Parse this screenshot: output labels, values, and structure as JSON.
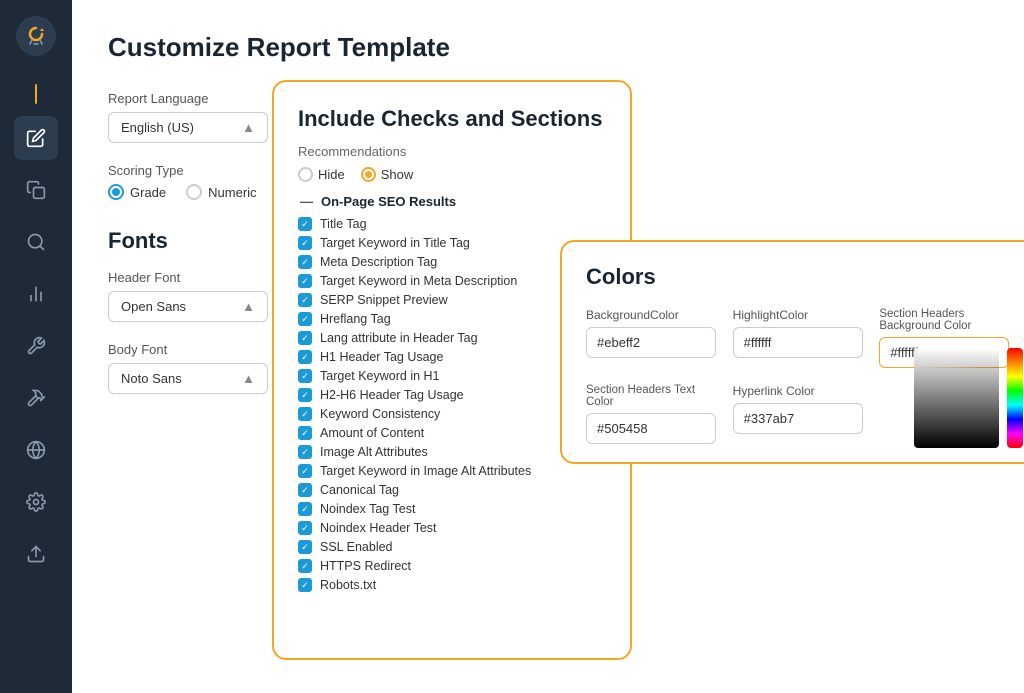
{
  "sidebar": {
    "logo": "↺",
    "items": [
      {
        "name": "edit",
        "icon": "✎",
        "active": true
      },
      {
        "name": "copy",
        "icon": "❐",
        "active": false
      },
      {
        "name": "search",
        "icon": "🔍",
        "active": false
      },
      {
        "name": "chart",
        "icon": "📊",
        "active": false
      },
      {
        "name": "tool",
        "icon": "🔧",
        "active": false
      },
      {
        "name": "hammer",
        "icon": "🔨",
        "active": false
      },
      {
        "name": "globe",
        "icon": "🌐",
        "active": false
      },
      {
        "name": "settings",
        "icon": "⚙",
        "active": false
      },
      {
        "name": "upload",
        "icon": "↑",
        "active": false
      }
    ]
  },
  "page": {
    "title": "Customize Report Template",
    "report_language_label": "Report Language",
    "report_language_value": "English (US)",
    "scoring_type_label": "Scoring Type",
    "scoring_grade_label": "Grade",
    "scoring_numeric_label": "Numeric",
    "fonts_title": "Fonts",
    "header_font_label": "Header Font",
    "header_font_value": "Open Sans",
    "body_font_label": "Body Font",
    "body_font_value": "Noto Sans"
  },
  "checks_panel": {
    "title": "Include Checks and Sections",
    "recommendations_label": "Recommendations",
    "hide_label": "Hide",
    "show_label": "Show",
    "section_header": "On-Page SEO Results",
    "items": [
      "Title Tag",
      "Target Keyword in Title Tag",
      "Meta Description Tag",
      "Target Keyword in Meta Description",
      "SERP Snippet Preview",
      "Hreflang Tag",
      "Lang attribute in Header Tag",
      "H1 Header Tag Usage",
      "Target Keyword in H1",
      "H2-H6 Header Tag Usage",
      "Keyword Consistency",
      "Amount of Content",
      "Image Alt Attributes",
      "Target Keyword in Image Alt Attributes",
      "Canonical Tag",
      "Noindex Tag Test",
      "Noindex Header Test",
      "SSL Enabled",
      "HTTPS Redirect",
      "Robots.txt"
    ]
  },
  "colors_panel": {
    "title": "Colors",
    "fields": [
      {
        "label": "BackgroundColor",
        "value": "#ebeff2"
      },
      {
        "label": "HighlightColor",
        "value": "#ffffff"
      },
      {
        "label": "Section Headers Background Color",
        "value": "#ffffff",
        "active": true
      },
      {
        "label": "Section Headers Text Color",
        "value": "#505458"
      },
      {
        "label": "Hyperlink Color",
        "value": "#337ab7"
      }
    ]
  }
}
